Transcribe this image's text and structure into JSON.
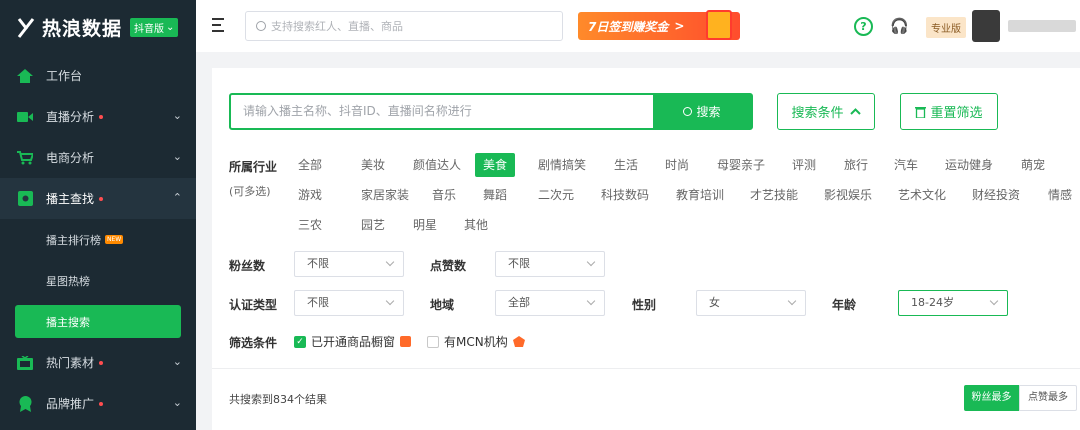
{
  "app": {
    "logo_text": "热浪数据",
    "version_badge": "抖音版"
  },
  "sidebar": {
    "items": [
      {
        "label": "工作台"
      },
      {
        "label": "直播分析"
      },
      {
        "label": "电商分析"
      },
      {
        "label": "播主查找"
      },
      {
        "label": "热门素材"
      },
      {
        "label": "品牌推广"
      }
    ],
    "sub_items": [
      {
        "label": "播主排行榜",
        "badge": "NEW"
      },
      {
        "label": "星图热榜"
      },
      {
        "label": "播主搜索"
      }
    ]
  },
  "topbar": {
    "search_placeholder": "支持搜索红人、直播、商品",
    "banner_text": "7日签到赚奖金",
    "banner_arrow": ">",
    "help_glyph": "?",
    "plan_badge": "专业版"
  },
  "main": {
    "search_placeholder": "请输入播主名称、抖音ID、直播间名称进行",
    "search_button": "搜索",
    "conditions_button": "搜索条件",
    "reset_button": "重置筛选",
    "industry_label": "所属行业",
    "industry_hint": "(可多选)",
    "industries": [
      "全部",
      "美妆",
      "颜值达人",
      "美食",
      "剧情搞笑",
      "生活",
      "时尚",
      "母婴亲子",
      "评测",
      "旅行",
      "汽车",
      "运动健身",
      "萌宠",
      "游戏",
      "家居家装",
      "音乐",
      "舞蹈",
      "二次元",
      "科技数码",
      "教育培训",
      "才艺技能",
      "影视娱乐",
      "艺术文化",
      "财经投资",
      "情感",
      "三农",
      "园艺",
      "明星",
      "其他"
    ],
    "selected_industry": "美食",
    "fans_label": "粉丝数",
    "fans_value": "不限",
    "likes_label": "点赞数",
    "likes_value": "不限",
    "verify_label": "认证类型",
    "verify_value": "不限",
    "region_label": "地域",
    "region_value": "全部",
    "gender_label": "性别",
    "gender_value": "女",
    "age_label": "年龄",
    "age_value": "18-24岁",
    "filter_label": "筛选条件",
    "filter_options": [
      {
        "label": "已开通商品橱窗",
        "checked": true
      },
      {
        "label": "有MCN机构",
        "checked": false
      }
    ],
    "result_text": "共搜索到834个结果",
    "sort_options": [
      "粉丝最多",
      "点赞最多"
    ]
  },
  "colors": {
    "accent": "#19b955",
    "sidebar_bg": "#1c2a33",
    "dot": "#ff4d4f"
  }
}
